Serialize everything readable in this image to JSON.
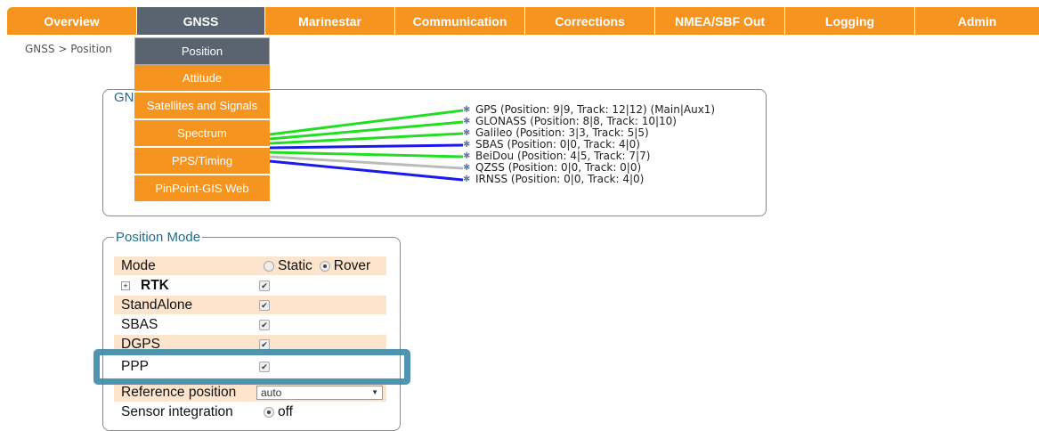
{
  "nav": {
    "tabs": [
      {
        "label": "Overview"
      },
      {
        "label": "GNSS"
      },
      {
        "label": "Marinestar"
      },
      {
        "label": "Communication"
      },
      {
        "label": "Corrections"
      },
      {
        "label": "NMEA/SBF Out"
      },
      {
        "label": "Logging"
      },
      {
        "label": "Admin"
      }
    ],
    "active": "GNSS"
  },
  "breadcrumb": "GNSS > Position",
  "gnss_menu": {
    "items": [
      {
        "label": "Position"
      },
      {
        "label": "Attitude"
      },
      {
        "label": "Satellites and Signals"
      },
      {
        "label": "Spectrum"
      },
      {
        "label": "PPS/Timing"
      },
      {
        "label": "PinPoint-GIS Web"
      }
    ],
    "active": "Position"
  },
  "constellation_box": {
    "legend_partial": "GN",
    "signals": [
      {
        "text": "GPS (Position: 9|9, Track: 12|12) (Main|Aux1)",
        "line_color": "#22dd22"
      },
      {
        "text": "GLONASS (Position: 8|8, Track: 10|10)",
        "line_color": "#22dd22"
      },
      {
        "text": "Galileo (Position: 3|3, Track: 5|5)",
        "line_color": "#22dd22"
      },
      {
        "text": "SBAS (Position: 0|0, Track: 4|0)",
        "line_color": "#1a1aee"
      },
      {
        "text": "BeiDou (Position: 4|5, Track: 7|7)",
        "line_color": "#22dd22"
      },
      {
        "text": "QZSS (Position: 0|0, Track: 0|0)",
        "line_color": "#bbbbbb"
      },
      {
        "text": "IRNSS (Position: 0|0, Track: 4|0)",
        "line_color": "#1a1aee"
      }
    ]
  },
  "position_mode": {
    "legend": "Position Mode",
    "mode_label": "Mode",
    "mode_options": [
      {
        "label": "Static",
        "selected": false
      },
      {
        "label": "Rover",
        "selected": true
      }
    ],
    "rtk_label": "RTK",
    "rtk_expand": "+",
    "rows": [
      {
        "label": "StandAlone",
        "checked": true
      },
      {
        "label": "SBAS",
        "checked": true
      },
      {
        "label": "DGPS",
        "checked": true
      },
      {
        "label": "PPP",
        "checked": true
      }
    ],
    "rtk_checked": true,
    "reference_position_label": "Reference position",
    "reference_position_value": "auto",
    "sensor_integration_label": "Sensor integration",
    "sensor_integration_value": "off",
    "checkmark": "✔"
  },
  "colors": {
    "nav_orange": "#f5941e",
    "nav_active": "#5a6470",
    "legend_blue": "#1b6d8f",
    "highlight": "#3d8aa6",
    "row_alt": "#fde4cc"
  }
}
